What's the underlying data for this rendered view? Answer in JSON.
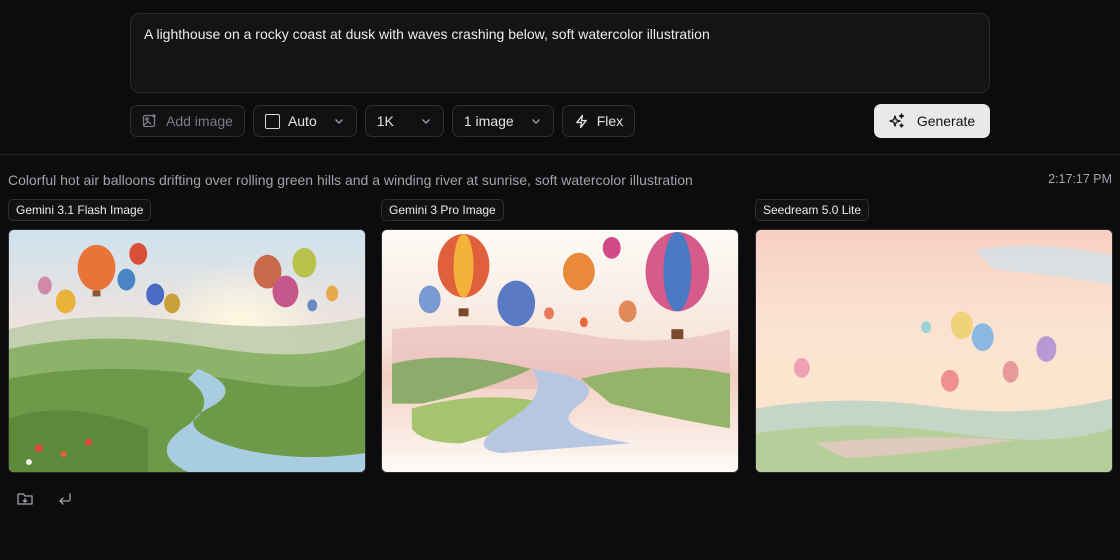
{
  "prompt": {
    "value": "A lighthouse on a rocky coast at dusk with waves crashing below, soft watercolor illustration"
  },
  "toolbar": {
    "add_image_label": "Add image",
    "aspect_label": "Auto",
    "resolution_label": "1K",
    "count_label": "1 image",
    "mode_label": "Flex",
    "generate_label": "Generate"
  },
  "result": {
    "prompt": "Colorful hot air balloons drifting over rolling green hills and a winding river at sunrise, soft watercolor illustration",
    "timestamp": "2:17:17 PM",
    "cards": [
      {
        "model": "Gemini 3.1 Flash Image"
      },
      {
        "model": "Gemini 3 Pro Image"
      },
      {
        "model": "Seedream 5.0 Lite"
      }
    ]
  },
  "icons": {
    "add_image": "image-plus-icon",
    "aspect": "square-icon",
    "chevron": "chevron-down-icon",
    "mode": "lightning-icon",
    "generate": "sparkles-icon",
    "save": "folder-download-icon",
    "reuse": "return-arrow-icon"
  },
  "colors": {
    "background": "#0c0c0e",
    "generate_bg": "#e9e9eb",
    "border": "#2e2e33"
  }
}
